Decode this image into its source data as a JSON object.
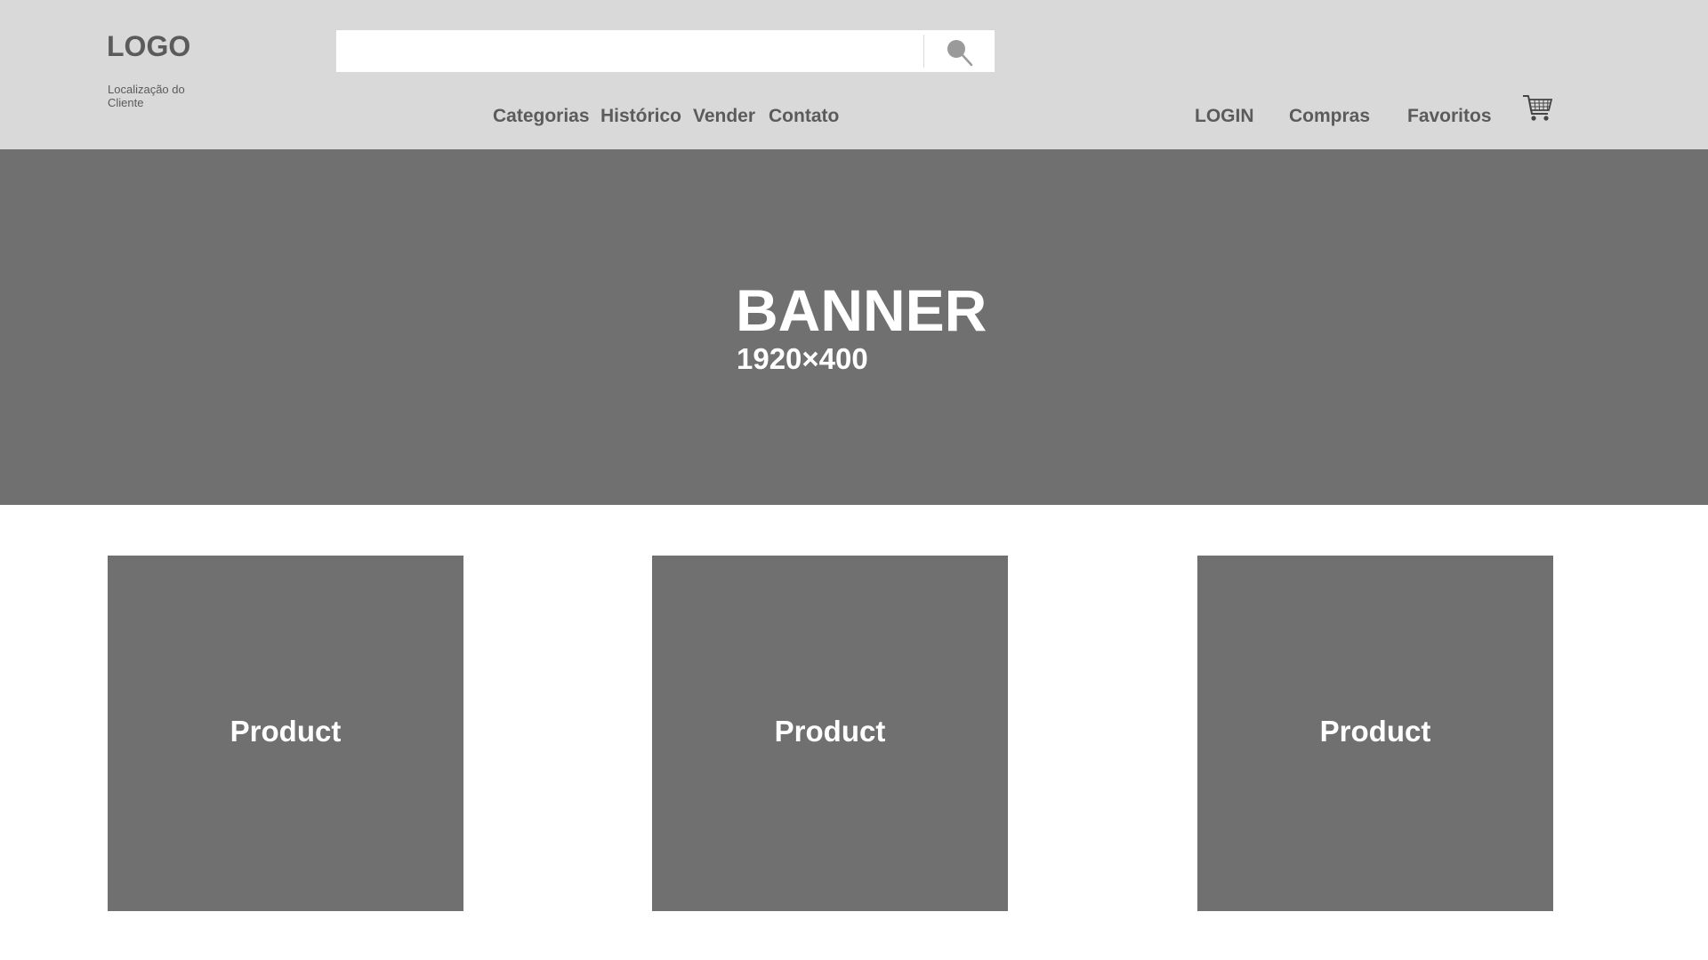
{
  "header": {
    "logo": "LOGO",
    "location": "Localização do Cliente",
    "search": {
      "value": "",
      "placeholder": ""
    },
    "nav": [
      "Categorias",
      "Histórico",
      "Vender",
      "Contato"
    ],
    "user_nav": [
      "LOGIN",
      "Compras",
      "Favoritos"
    ],
    "icons": {
      "search": "search-icon",
      "cart": "shopping-cart-icon"
    }
  },
  "banner": {
    "title": "BANNER",
    "size": "1920×400"
  },
  "products": [
    {
      "label": "Product"
    },
    {
      "label": "Product"
    },
    {
      "label": "Product"
    }
  ],
  "colors": {
    "header_bg": "#d9d9d9",
    "placeholder_bg": "#707070",
    "text_dark": "#5b5b5b",
    "text_light": "#ffffff"
  }
}
